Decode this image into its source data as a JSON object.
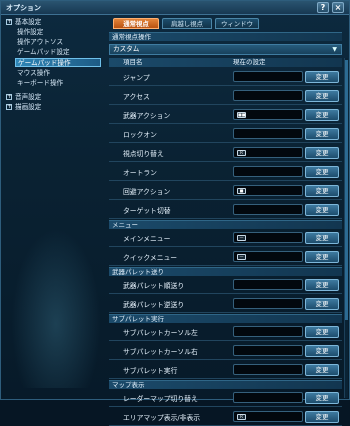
{
  "window": {
    "title": "オプション",
    "help": "?",
    "close": "×"
  },
  "sidebar": {
    "items": [
      {
        "label": "基本設定",
        "kind": "cat"
      },
      {
        "label": "操作設定",
        "kind": "sub"
      },
      {
        "label": "操作アウトソス",
        "kind": "sub"
      },
      {
        "label": "ゲームパッド設定",
        "kind": "sub"
      },
      {
        "label": "ゲームパッド操作",
        "kind": "active"
      },
      {
        "label": "マウス操作",
        "kind": "sub"
      },
      {
        "label": "キーボード操作",
        "kind": "sub"
      },
      {
        "label": "音声設定",
        "kind": "cat"
      },
      {
        "label": "描画設定",
        "kind": "cat"
      }
    ]
  },
  "tabs": [
    {
      "label": "通常視点",
      "active": true
    },
    {
      "label": "肩越し視点",
      "active": false
    },
    {
      "label": "ウィンドウ",
      "active": false
    }
  ],
  "section_title": "通常視点操作",
  "preset": "カスタム",
  "columns": {
    "name": "項目名",
    "current": "現在の設定"
  },
  "change_label": "変更",
  "groups": [
    {
      "header": "",
      "rows": [
        {
          "name": "ジャンプ",
          "key": ""
        },
        {
          "name": "アクセス",
          "key": ""
        },
        {
          "name": "武器アクション",
          "key": "■■"
        },
        {
          "name": "ロックオン",
          "key": ""
        },
        {
          "name": "視点切り替え",
          "key": "R"
        },
        {
          "name": "オートラン",
          "key": ""
        },
        {
          "name": "回避アクション",
          "key": "■"
        },
        {
          "name": "ターゲット切替",
          "key": ""
        }
      ]
    },
    {
      "header": "メニュー",
      "rows": [
        {
          "name": "メインメニュー",
          "key": "—"
        },
        {
          "name": "クイックメニュー",
          "key": "—"
        }
      ]
    },
    {
      "header": "武器パレット送り",
      "rows": [
        {
          "name": "武器パレット順送り",
          "key": ""
        },
        {
          "name": "武器パレット逆送り",
          "key": ""
        }
      ]
    },
    {
      "header": "サブパレット実行",
      "rows": [
        {
          "name": "サブパレットカーソル左",
          "key": ""
        },
        {
          "name": "サブパレットカーソル右",
          "key": ""
        },
        {
          "name": "サブパレット実行",
          "key": ""
        }
      ]
    },
    {
      "header": "マップ表示",
      "rows": [
        {
          "name": "レーダーマップ切り替え",
          "key": ""
        },
        {
          "name": "エリアマップ表示/非表示",
          "key": "R"
        }
      ]
    }
  ]
}
